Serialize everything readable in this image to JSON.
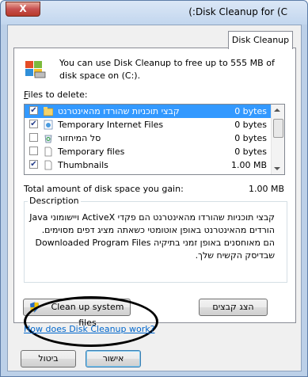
{
  "window": {
    "title": "(:Disk Cleanup for  (C",
    "close_label": "X"
  },
  "tab": {
    "label": "Disk Cleanup"
  },
  "intro": "You can use Disk Cleanup to free up to 555 MB of disk space on  (C:).",
  "files_label_underlined": "F",
  "files_label_rest": "iles to delete:",
  "files": [
    {
      "name": "קבצי תוכניות שהורדו מהאינטרנט",
      "size": "0 bytes",
      "checked": true,
      "selected": true,
      "icon": "folder-icon"
    },
    {
      "name": "Temporary Internet Files",
      "size": "0 bytes",
      "checked": true,
      "selected": false,
      "icon": "internet-files-icon"
    },
    {
      "name": "סל המיחזור",
      "size": "0 bytes",
      "checked": false,
      "selected": false,
      "icon": "recycle-bin-icon"
    },
    {
      "name": "Temporary files",
      "size": "0 bytes",
      "checked": false,
      "selected": false,
      "icon": "file-icon"
    },
    {
      "name": "Thumbnails",
      "size": "1.00 MB",
      "checked": true,
      "selected": false,
      "icon": "file-icon"
    }
  ],
  "total_label": "Total amount of disk space you gain:",
  "total_value": "1.00 MB",
  "description_title": "Description",
  "description_text": "קבצי תוכניות שהורדו מהאינטרנט הם פקדי ActiveX ויישומוני Java הורדים מהאינטרנט באופן אוטומטי כשאתה מציג דפים מסוימים. הם מאוחסנים באופן זמני בתיקיה Downloaded Program Files שבדיסק הקשיח שלך.",
  "cleanup_button": "Clean up system files",
  "view_files_button": "הצג קבצים",
  "help_link": "How does Disk Cleanup work?",
  "ok_button": "אישור",
  "cancel_button": "ביטול",
  "colors": {
    "selection": "#3399ff",
    "link": "#0066cc"
  }
}
